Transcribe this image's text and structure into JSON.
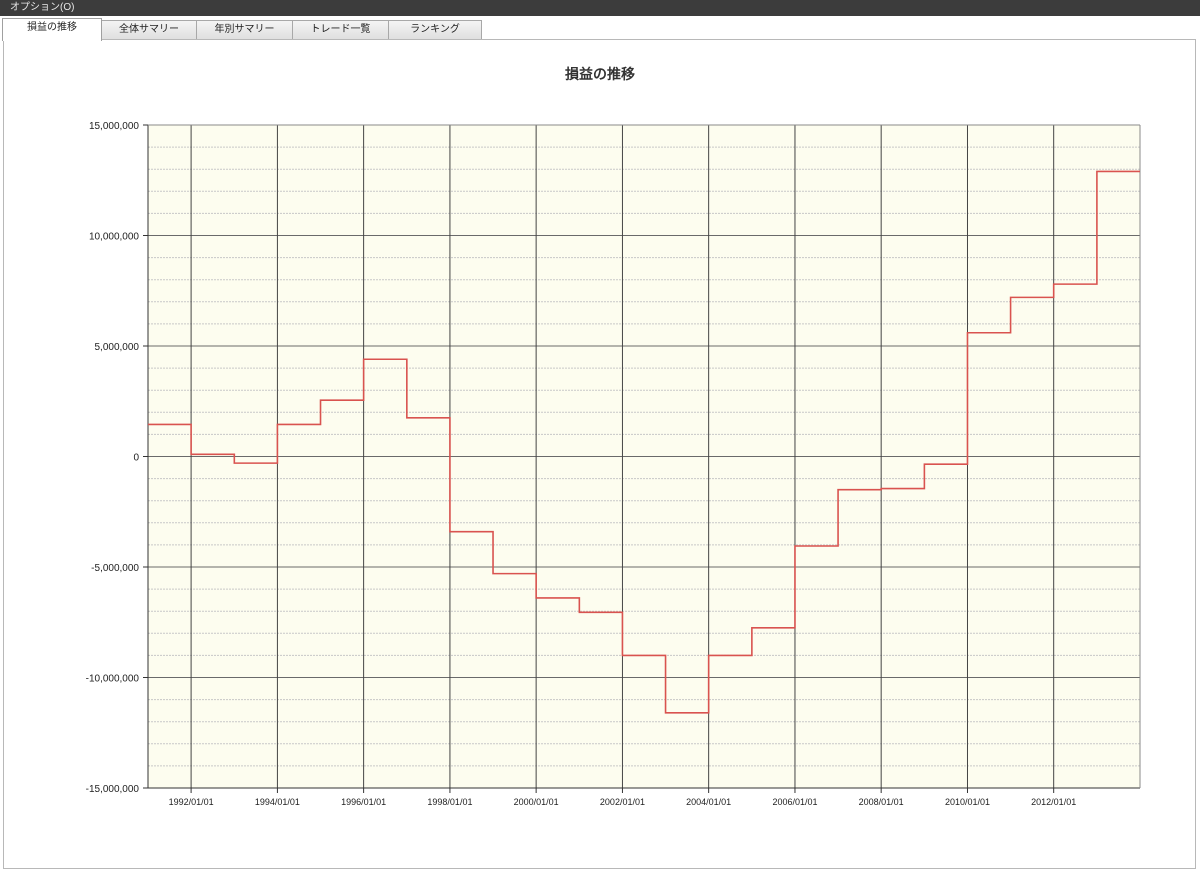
{
  "window": {
    "title": "オプション(O)"
  },
  "tabs": [
    {
      "label": "損益の推移",
      "active": true
    },
    {
      "label": "全体サマリー",
      "active": false
    },
    {
      "label": "年別サマリー",
      "active": false
    },
    {
      "label": "トレード一覧",
      "active": false
    },
    {
      "label": "ランキング",
      "active": false
    }
  ],
  "colors": {
    "plot_background": "#fdfdef",
    "line": "#d9534f",
    "major_grid": "#444444",
    "minor_grid": "#c8c8c8"
  },
  "chart_data": {
    "type": "line",
    "step": true,
    "title": "損益の推移",
    "xlabel": "",
    "ylabel": "",
    "x_tick_labels": [
      "1992/01/01",
      "1994/01/01",
      "1996/01/01",
      "1998/01/01",
      "2000/01/01",
      "2002/01/01",
      "2004/01/01",
      "2006/01/01",
      "2008/01/01",
      "2010/01/01",
      "2012/01/01"
    ],
    "y_tick_labels": [
      "15,000,000",
      "10,000,000",
      "5,000,000",
      "0",
      "-5,000,000",
      "-10,000,000",
      "-15,000,000"
    ],
    "xlim": [
      "1991/01/01",
      "2014/01/01"
    ],
    "ylim": [
      -15000000,
      15000000
    ],
    "grid": true,
    "legend": "none",
    "series": [
      {
        "x": [
          "1991/01/01",
          "1992/01/01",
          "1993/01/01",
          "1994/01/01",
          "1995/01/01",
          "1996/01/01",
          "1997/01/01",
          "1998/01/01",
          "1999/01/01",
          "2000/01/01",
          "2001/01/01",
          "2002/01/01",
          "2003/01/01",
          "2004/01/01",
          "2005/01/01",
          "2006/01/01",
          "2007/01/01",
          "2008/01/01",
          "2009/01/01",
          "2010/01/01",
          "2011/01/01",
          "2012/01/01",
          "2013/01/01"
        ],
        "values": [
          1450000,
          100000,
          -300000,
          1450000,
          2550000,
          4400000,
          1750000,
          -3400000,
          -5300000,
          -6400000,
          -7050000,
          -9000000,
          -11600000,
          -9000000,
          -7750000,
          -4050000,
          -1500000,
          -1450000,
          -350000,
          5600000,
          7200000,
          7800000,
          12900000
        ]
      }
    ]
  }
}
